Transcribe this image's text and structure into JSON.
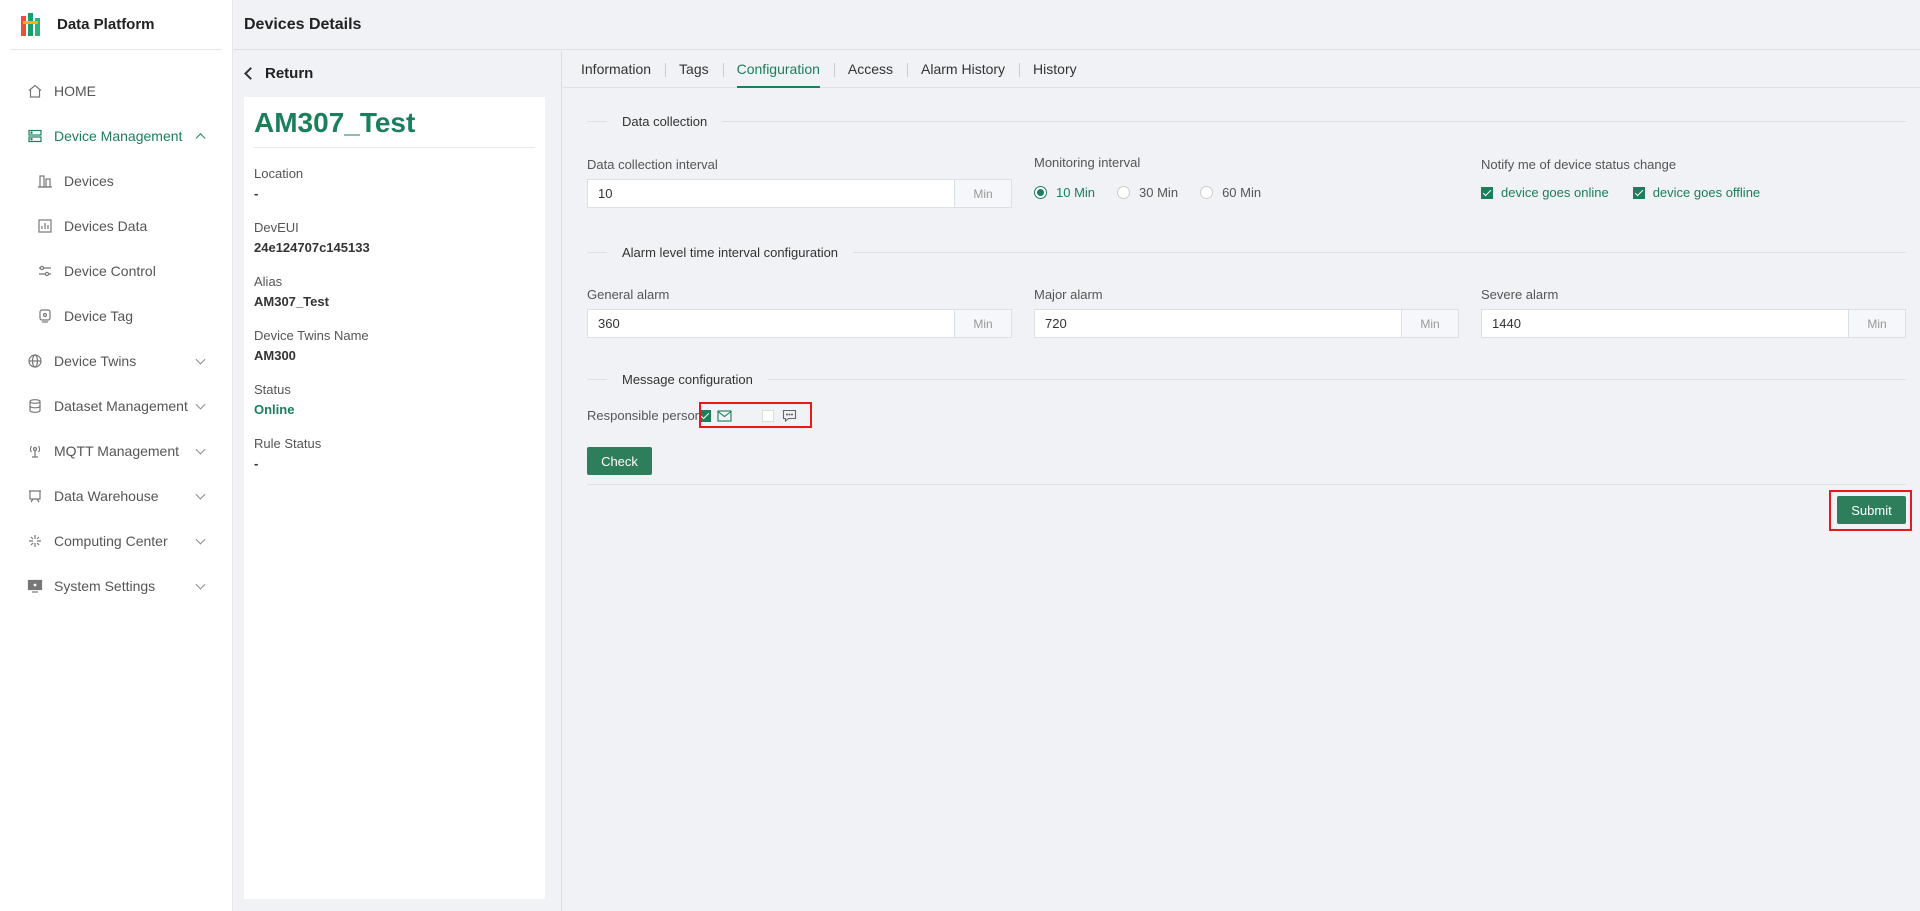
{
  "app": {
    "title": "Data Platform"
  },
  "header": {
    "title": "Devices Details"
  },
  "sidebar": {
    "items": [
      {
        "label": "HOME"
      },
      {
        "label": "Device Management"
      },
      {
        "label": "Devices"
      },
      {
        "label": "Devices Data"
      },
      {
        "label": "Device Control"
      },
      {
        "label": "Device Tag"
      },
      {
        "label": "Device Twins"
      },
      {
        "label": "Dataset Management"
      },
      {
        "label": "MQTT Management"
      },
      {
        "label": "Data Warehouse"
      },
      {
        "label": "Computing Center"
      },
      {
        "label": "System Settings"
      }
    ]
  },
  "detail": {
    "return_label": "Return",
    "name": "AM307_Test",
    "fields": [
      {
        "label": "Location",
        "value": "-"
      },
      {
        "label": "DevEUI",
        "value": "24e124707c145133"
      },
      {
        "label": "Alias",
        "value": "AM307_Test"
      },
      {
        "label": "Device Twins Name",
        "value": "AM300"
      },
      {
        "label": "Status",
        "value": "Online"
      },
      {
        "label": "Rule Status",
        "value": "-"
      }
    ]
  },
  "tabs": [
    {
      "label": "Information"
    },
    {
      "label": "Tags"
    },
    {
      "label": "Configuration"
    },
    {
      "label": "Access"
    },
    {
      "label": "Alarm History"
    },
    {
      "label": "History"
    }
  ],
  "active_tab": "Configuration",
  "config": {
    "data_collection": {
      "title": "Data collection",
      "interval_label": "Data collection interval",
      "interval_value": "10",
      "unit": "Min",
      "monitoring_label": "Monitoring interval",
      "monitoring_options": [
        "10 Min",
        "30 Min",
        "60 Min"
      ],
      "monitoring_selected": "10 Min",
      "notify_label": "Notify me of device status change",
      "notify_online": "device goes online",
      "notify_offline": "device goes offline"
    },
    "alarm": {
      "title": "Alarm level time interval configuration",
      "general_label": "General alarm",
      "general_value": "360",
      "major_label": "Major alarm",
      "major_value": "720",
      "severe_label": "Severe alarm",
      "severe_value": "1440",
      "unit": "Min"
    },
    "message": {
      "title": "Message configuration",
      "responsible_label": "Responsible person",
      "email_checked": true,
      "sms_checked": false
    },
    "check_label": "Check",
    "submit_label": "Submit"
  },
  "colors": {
    "accent": "#1a7f5a",
    "button": "#2e7d5b",
    "highlight": "#e31b1b"
  }
}
